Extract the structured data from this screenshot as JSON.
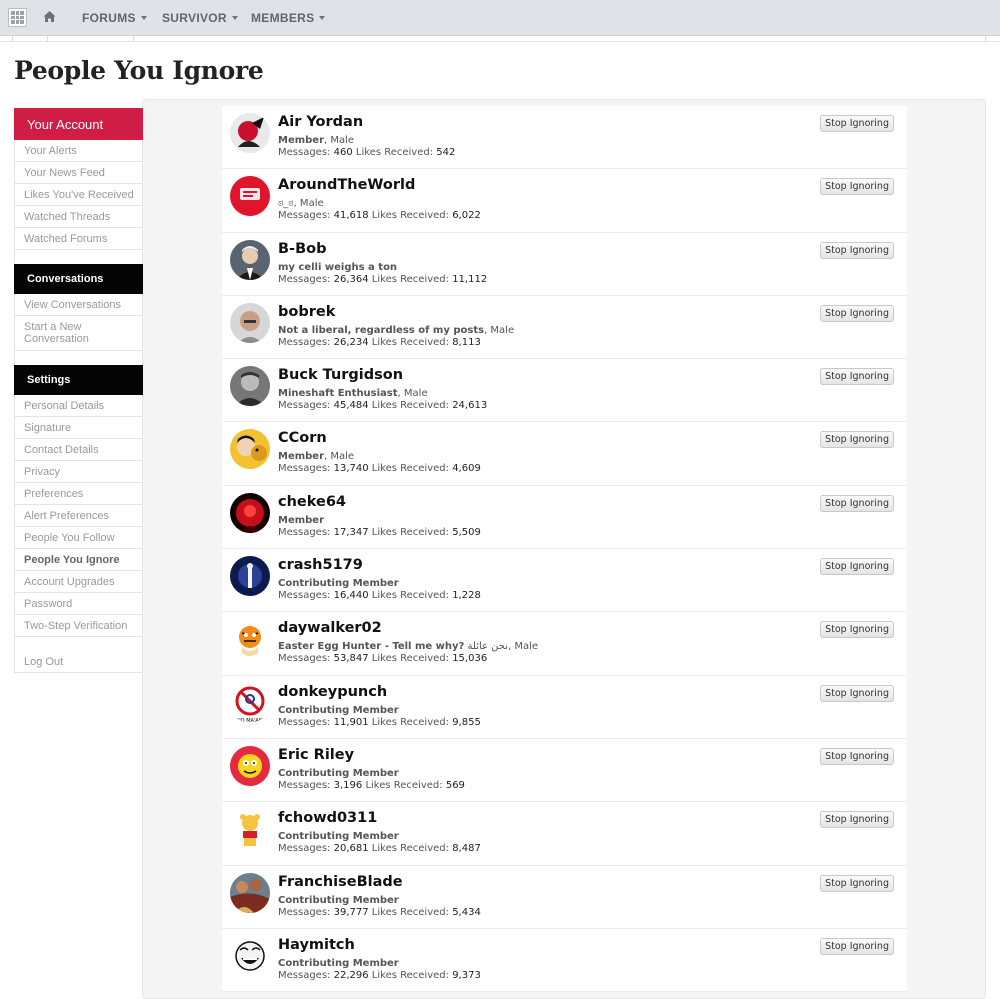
{
  "nav": {
    "items": [
      {
        "label": "FORUMS"
      },
      {
        "label": "SURVIVOR"
      },
      {
        "label": "MEMBERS"
      }
    ]
  },
  "page_title": "People You Ignore",
  "sidebar": {
    "account_header": "Your Account",
    "account_items": [
      "Your Alerts",
      "Your News Feed",
      "Likes You've Received",
      "Watched Threads",
      "Watched Forums"
    ],
    "conversations_header": "Conversations",
    "conversations_items": [
      "View Conversations",
      "Start a New Conversation"
    ],
    "settings_header": "Settings",
    "settings_items": [
      "Personal Details",
      "Signature",
      "Contact Details",
      "Privacy",
      "Preferences",
      "Alert Preferences",
      "People You Follow",
      "People You Ignore",
      "Account Upgrades",
      "Password",
      "Two-Step Verification"
    ],
    "logout": "Log Out"
  },
  "labels": {
    "messages": "Messages:",
    "likes": "Likes Received:",
    "stop": "Stop Ignoring"
  },
  "members": [
    {
      "name": "Air Yordan",
      "title": "Member",
      "extra": ", Male",
      "messages": "460",
      "likes": "542",
      "avatar": "red-black-character"
    },
    {
      "name": "AroundTheWorld",
      "title": "",
      "extra": "ಠ_ಠ, Male",
      "messages": "41,618",
      "likes": "6,022",
      "avatar": "red-logo"
    },
    {
      "name": "B-Bob",
      "title": "my celli weighs a ton",
      "extra": "",
      "messages": "26,364",
      "likes": "11,112",
      "avatar": "man-photo"
    },
    {
      "name": "bobrek",
      "title": "Not a liberal, regardless of my posts",
      "extra": ", Male",
      "messages": "26,234",
      "likes": "8,113",
      "avatar": "bald-man-photo"
    },
    {
      "name": "Buck Turgidson",
      "title": "Mineshaft Enthusiast",
      "extra": ", Male",
      "messages": "45,484",
      "likes": "24,613",
      "avatar": "bw-man-photo"
    },
    {
      "name": "CCorn",
      "title": "Member",
      "extra": ", Male",
      "messages": "13,740",
      "likes": "4,609",
      "avatar": "cartoon-man"
    },
    {
      "name": "cheke64",
      "title": "Member",
      "extra": "",
      "messages": "17,347",
      "likes": "5,509",
      "avatar": "red-glow-figure"
    },
    {
      "name": "crash5179",
      "title": "Contributing Member",
      "extra": "",
      "messages": "16,440",
      "likes": "1,228",
      "avatar": "blue-figure"
    },
    {
      "name": "daywalker02",
      "title": "Easter Egg Hunter - Tell me why?",
      "extra": " نحن عائلة, Male",
      "messages": "53,847",
      "likes": "15,036",
      "avatar": "tiger-cartoon"
    },
    {
      "name": "donkeypunch",
      "title": "Contributing Member",
      "extra": "",
      "messages": "11,901",
      "likes": "9,855",
      "avatar": "no-symbol"
    },
    {
      "name": "Eric Riley",
      "title": "Contributing Member",
      "extra": "",
      "messages": "3,196",
      "likes": "569",
      "avatar": "yellow-cartoon"
    },
    {
      "name": "fchowd0311",
      "title": "Contributing Member",
      "extra": "",
      "messages": "20,681",
      "likes": "8,487",
      "avatar": "bear-cartoon"
    },
    {
      "name": "FranchiseBlade",
      "title": "Contributing Member",
      "extra": "",
      "messages": "39,777",
      "likes": "5,434",
      "avatar": "painting"
    },
    {
      "name": "Haymitch",
      "title": "Contributing Member",
      "extra": "",
      "messages": "22,296",
      "likes": "9,373",
      "avatar": "meme-face"
    }
  ]
}
